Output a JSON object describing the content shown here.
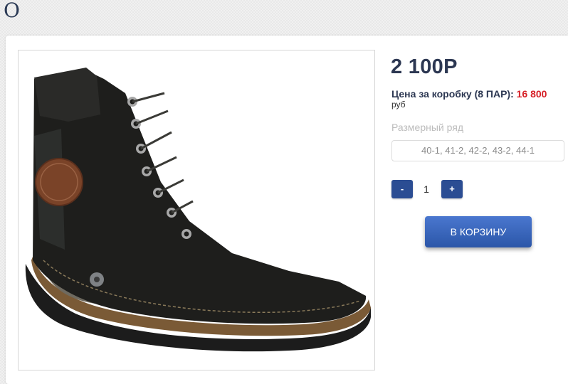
{
  "header": {
    "letter": "О"
  },
  "product": {
    "image_alt": "shoe-photo",
    "price": "2 100Р",
    "box_price_label": "Цена за коробку (8 ПАР):",
    "box_price_value": "16 800",
    "currency": "руб",
    "size_label": "Размерный ряд",
    "size_value": "40-1, 41-2, 42-2, 43-2, 44-1",
    "quantity": "1",
    "minus_label": "-",
    "plus_label": "+",
    "cart_button_label": "В КОРЗИНУ"
  },
  "colors": {
    "accent": "#2b4d93",
    "price_text": "#2c3752",
    "box_price_value": "#d61f26"
  }
}
